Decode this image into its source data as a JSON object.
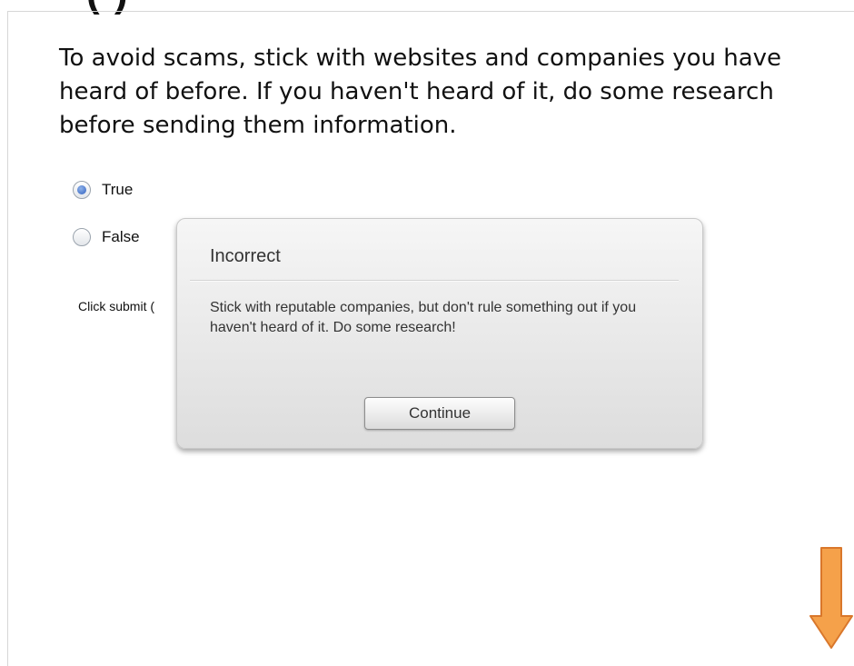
{
  "header": {
    "partial_title": "(        )"
  },
  "question": {
    "text": "To avoid scams, stick with websites and companies you have heard of before. If you haven't heard of it, do some research before sending them information."
  },
  "options": [
    {
      "label": "True",
      "selected": true
    },
    {
      "label": "False",
      "selected": false
    }
  ],
  "hint": {
    "text": "Click submit ("
  },
  "modal": {
    "title": "Incorrect",
    "message": "Stick with reputable companies, but don't rule something out if you haven't heard of it. Do some research!",
    "continue_label": "Continue"
  },
  "colors": {
    "arrow": "#f5a14a",
    "arrow_outline": "#d9772b",
    "radio_selected": "#2f5fbf"
  },
  "icons": {
    "next": "down-arrow-icon"
  }
}
